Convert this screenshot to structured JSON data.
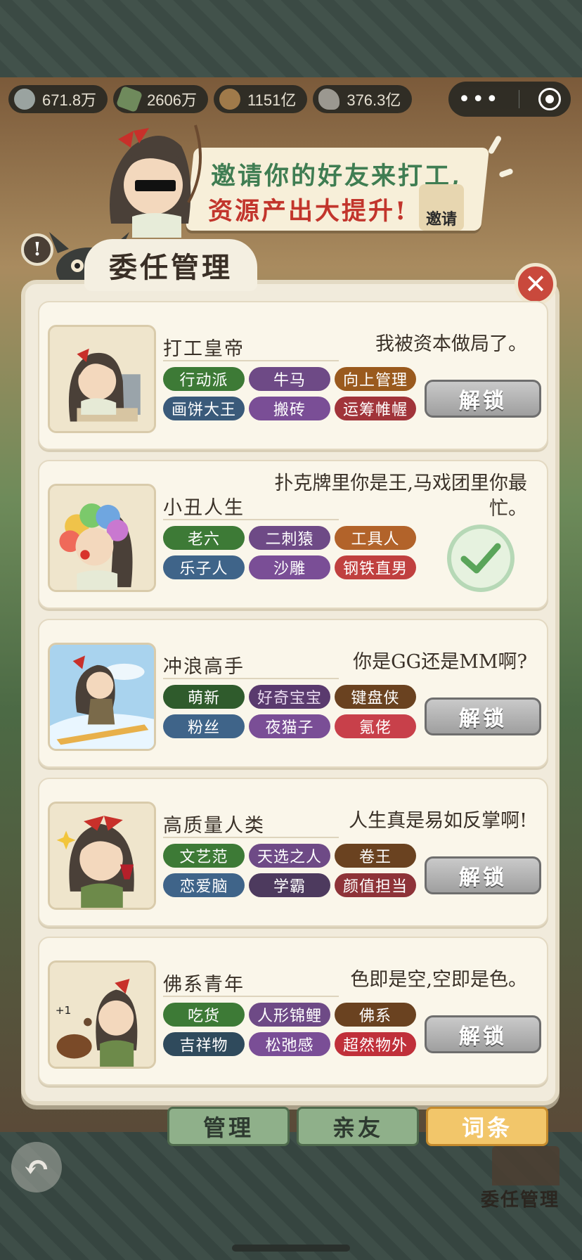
{
  "resources": [
    {
      "name": "silver",
      "value": "671.8万",
      "icon_color": "#9aa3a0"
    },
    {
      "name": "tea-brick",
      "value": "2606万",
      "icon_color": "#6f8a5c"
    },
    {
      "name": "wood",
      "value": "1151亿",
      "icon_color": "#a07a4a"
    },
    {
      "name": "stone",
      "value": "376.3亿",
      "icon_color": "#9b9890"
    }
  ],
  "capsule": {
    "more": "•••"
  },
  "banner": {
    "line1": "邀请你的好友来打工,",
    "line2": "资源产出大提升!",
    "badge_label": "邀请"
  },
  "panel": {
    "title": "委任管理",
    "info_icon": "!"
  },
  "cards": [
    {
      "name": "打工皇帝",
      "quote": "我被资本做局了。",
      "tags": [
        {
          "label": "行动派",
          "color": "#3d7a36"
        },
        {
          "label": "牛马",
          "color": "#6e4a86"
        },
        {
          "label": "向上管理",
          "color": "#9a5a1e"
        },
        {
          "label": "画饼大王",
          "color": "#3a5a7a"
        },
        {
          "label": "搬砖",
          "color": "#7a4e96"
        },
        {
          "label": "运筹帷幄",
          "color": "#a1343a"
        }
      ],
      "action": "解锁",
      "unlocked": false
    },
    {
      "name": "小丑人生",
      "quote": "扑克牌里你是王,马戏团里你最忙。",
      "tags": [
        {
          "label": "老六",
          "color": "#3d7a36"
        },
        {
          "label": "二刺猿",
          "color": "#6e4a86"
        },
        {
          "label": "工具人",
          "color": "#b2632a"
        },
        {
          "label": "乐子人",
          "color": "#3f6489"
        },
        {
          "label": "沙雕",
          "color": "#7a4e96"
        },
        {
          "label": "钢铁直男",
          "color": "#c0403f"
        }
      ],
      "action": "",
      "unlocked": true
    },
    {
      "name": "冲浪高手",
      "quote": "你是GG还是MM啊?",
      "tags": [
        {
          "label": "萌新",
          "color": "#2f5b2c"
        },
        {
          "label": "好奇宝宝",
          "color": "#5a3a6e"
        },
        {
          "label": "键盘侠",
          "color": "#6a4220"
        },
        {
          "label": "粉丝",
          "color": "#3f6489"
        },
        {
          "label": "夜猫子",
          "color": "#7a4e96"
        },
        {
          "label": "氪佬",
          "color": "#c8404a"
        }
      ],
      "action": "解锁",
      "unlocked": false
    },
    {
      "name": "高质量人类",
      "quote": "人生真是易如反掌啊!",
      "tags": [
        {
          "label": "文艺范",
          "color": "#3d7a36"
        },
        {
          "label": "天选之人",
          "color": "#6e4a86"
        },
        {
          "label": "卷王",
          "color": "#6a4220"
        },
        {
          "label": "恋爱脑",
          "color": "#3f6489"
        },
        {
          "label": "学霸",
          "color": "#4d3a5e"
        },
        {
          "label": "颜值担当",
          "color": "#8e3338"
        }
      ],
      "action": "解锁",
      "unlocked": false
    },
    {
      "name": "佛系青年",
      "quote": "色即是空,空即是色。",
      "tags": [
        {
          "label": "吃货",
          "color": "#3d7a36"
        },
        {
          "label": "人形锦鲤",
          "color": "#6e4a86"
        },
        {
          "label": "佛系",
          "color": "#6a4220"
        },
        {
          "label": "吉祥物",
          "color": "#2f4a5c"
        },
        {
          "label": "松弛感",
          "color": "#7a4e96"
        },
        {
          "label": "超然物外",
          "color": "#c0303a"
        }
      ],
      "action": "解锁",
      "unlocked": false
    }
  ],
  "bottom_tabs": [
    {
      "label": "管理",
      "active": false
    },
    {
      "label": "亲友",
      "active": false
    },
    {
      "label": "词条",
      "active": true
    }
  ],
  "footer": {
    "corner_label": "委任管理"
  }
}
